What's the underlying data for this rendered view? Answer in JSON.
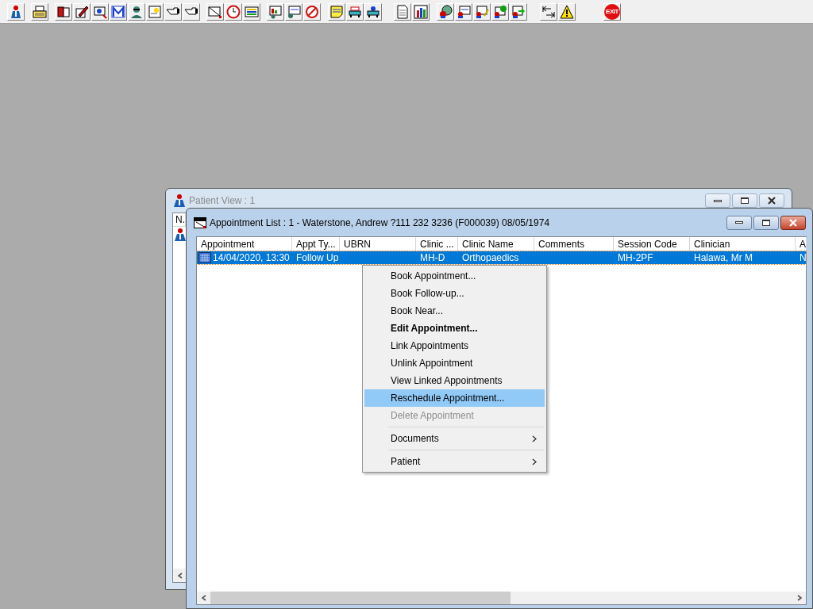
{
  "toolbar": {
    "exit_label": "EXIT"
  },
  "patient_window": {
    "title": "Patient View : 1",
    "active": false,
    "list_header": "N."
  },
  "appointment_window": {
    "title": "Appointment List : 1 - Waterstone, Andrew ?111 232 3236 (F000039) 08/05/1974",
    "active": true,
    "table": {
      "columns": [
        "Appointment",
        "Appt Ty...",
        "UBRN",
        "Clinic ...",
        "Clinic Name",
        "Comments",
        "Session Code",
        "Clinician",
        "A"
      ],
      "rows": [
        {
          "selected": true,
          "cells": [
            "14/04/2020, 13:30",
            "Follow Up",
            "",
            "MH-D",
            "Orthopaedics",
            "",
            "MH-2PF",
            "Halawa, Mr M",
            "N"
          ]
        }
      ]
    }
  },
  "context_menu": {
    "items": [
      {
        "kind": "item",
        "label": "Book Appointment...",
        "default": false,
        "disabled": false,
        "selected": false
      },
      {
        "kind": "item",
        "label": "Book Follow-up...",
        "default": false,
        "disabled": false,
        "selected": false
      },
      {
        "kind": "item",
        "label": "Book Near...",
        "default": false,
        "disabled": false,
        "selected": false
      },
      {
        "kind": "item",
        "label": "Edit Appointment...",
        "default": true,
        "disabled": false,
        "selected": false
      },
      {
        "kind": "item",
        "label": "Link Appointments",
        "default": false,
        "disabled": false,
        "selected": false
      },
      {
        "kind": "item",
        "label": "Unlink Appointment",
        "default": false,
        "disabled": false,
        "selected": false
      },
      {
        "kind": "item",
        "label": "View Linked Appointments",
        "default": false,
        "disabled": false,
        "selected": false
      },
      {
        "kind": "item",
        "label": "Reschedule Appointment...",
        "default": false,
        "disabled": false,
        "selected": true
      },
      {
        "kind": "item",
        "label": "Delete Appointment",
        "default": false,
        "disabled": true,
        "selected": false
      },
      {
        "kind": "separator"
      },
      {
        "kind": "submenu",
        "label": "Documents",
        "default": false,
        "disabled": false,
        "selected": false
      },
      {
        "kind": "separator"
      },
      {
        "kind": "submenu",
        "label": "Patient",
        "default": false,
        "disabled": false,
        "selected": false
      }
    ]
  }
}
